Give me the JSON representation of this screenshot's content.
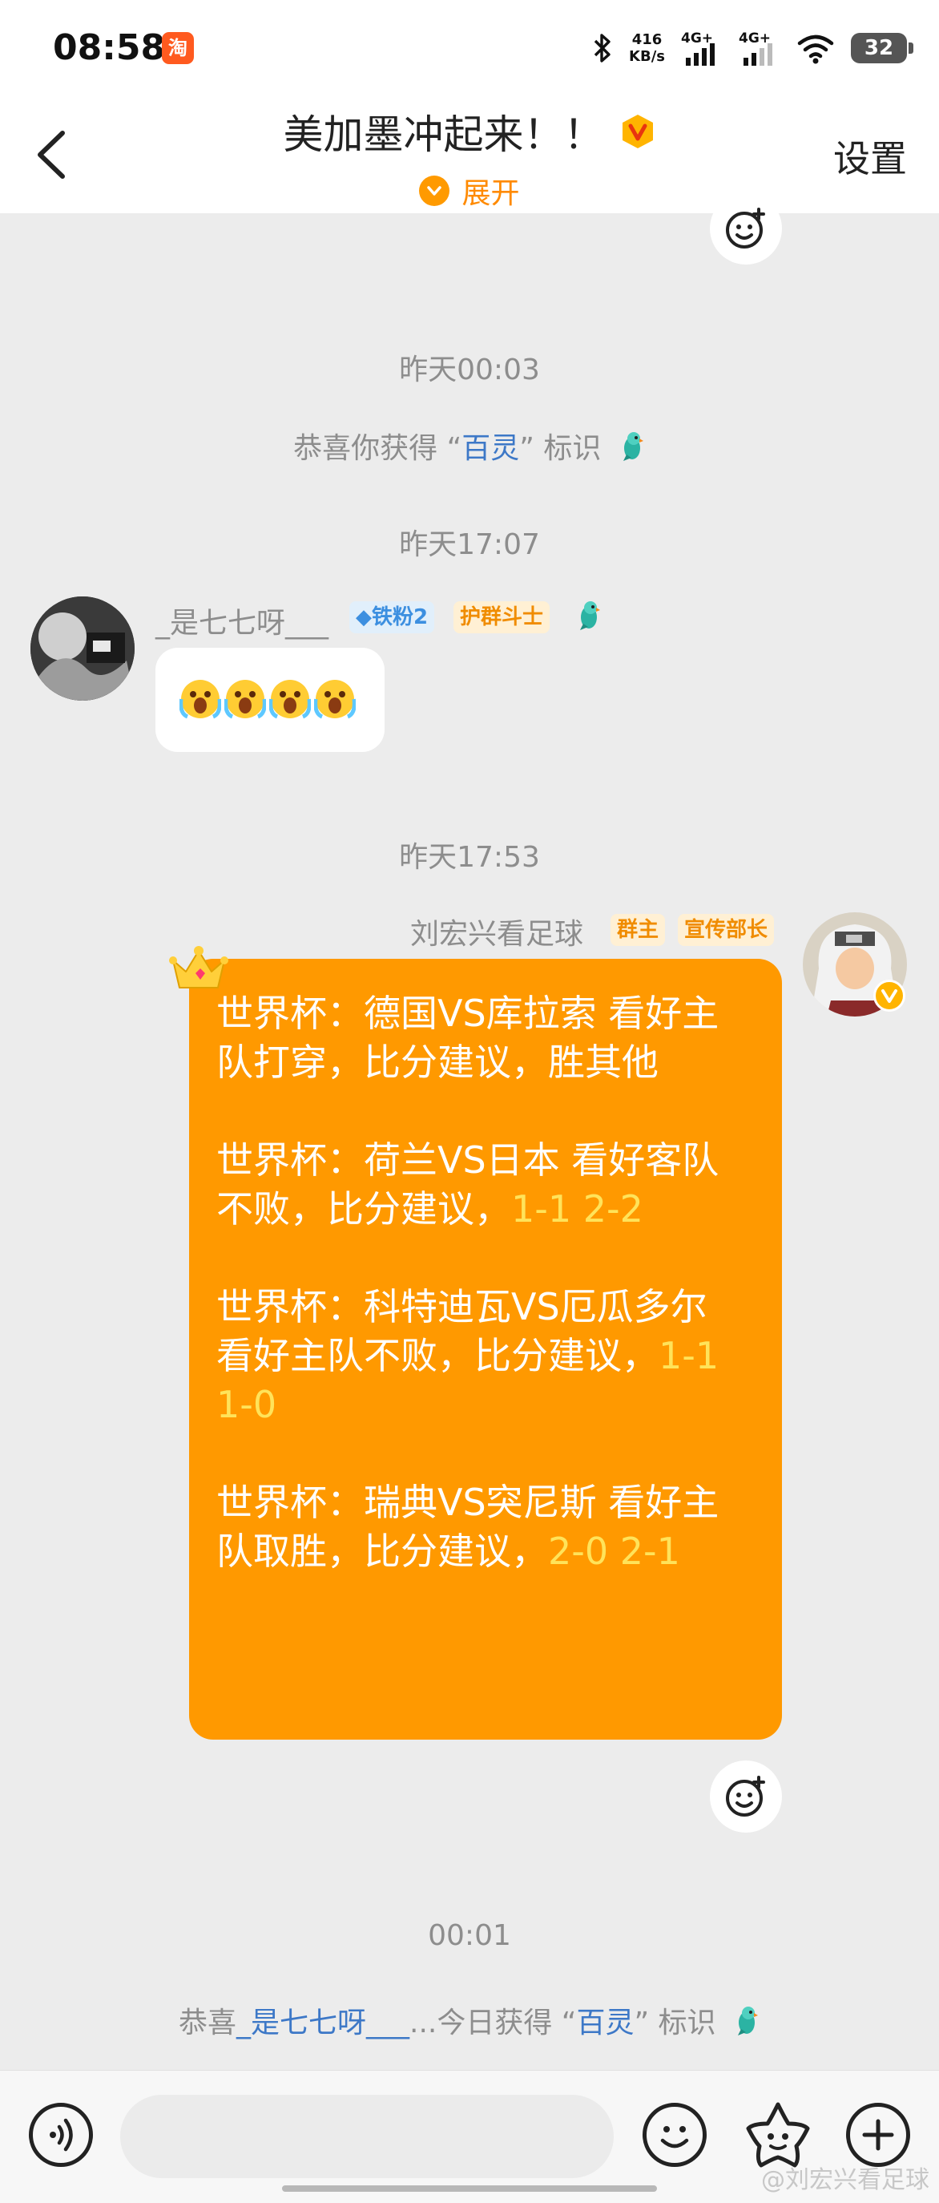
{
  "status_bar": {
    "time": "08:58",
    "app_icon": "app-notification-icon",
    "net_speed_value": "416",
    "net_speed_unit": "KB/s",
    "signal1_label": "4G+",
    "signal2_label": "4G+",
    "battery": "32"
  },
  "header": {
    "title": "美加墨冲起来！！",
    "expand_label": "展开",
    "settings_label": "设置"
  },
  "chat": {
    "sys_time_1": "昨天00:03",
    "sys_msg_1": {
      "prefix": "恭喜你获得 “",
      "highlight": "百灵",
      "suffix": "” 标识"
    },
    "time_2": "昨天17:07",
    "message_1": {
      "nickname": "_是七七呀___",
      "fan_badge": "铁粉2",
      "role_badge": "护群斗士",
      "emoji_count_label": "scream-face-emoji x4"
    },
    "time_3": "昨天17:53",
    "message_2": {
      "nickname": "刘宏兴看足球",
      "role_badge_1": "群主",
      "role_badge_2": "宣传部长",
      "paragraphs": [
        {
          "text": "世界杯：德国VS库拉索  看好主队打穿，比分建议，胜其他",
          "scores": ""
        },
        {
          "text": "世界杯：荷兰VS日本  看好客队不败，比分建议，",
          "scores": "1-1  2-2"
        },
        {
          "text": "世界杯：科特迪瓦VS厄瓜多尔  看好主队不败，比分建议，",
          "scores": "1-1  1-0"
        },
        {
          "text": "世界杯：瑞典VS突尼斯  看好主队取胜，比分建议，",
          "scores": "2-0  2-1"
        }
      ]
    },
    "time_4": "00:01",
    "sys_msg_2": {
      "prefix": "恭喜",
      "highlight_user": "_是七七呀___",
      "middle": "...今日获得 “",
      "highlight": "百灵",
      "suffix": "” 标识"
    }
  },
  "input_bar": {
    "placeholder": "",
    "voice_icon": "voice-icon",
    "emoji_icon": "emoji-icon",
    "sticker_icon": "sticker-icon",
    "plus_icon": "plus-icon"
  },
  "watermark": "@刘宏兴看足球"
}
